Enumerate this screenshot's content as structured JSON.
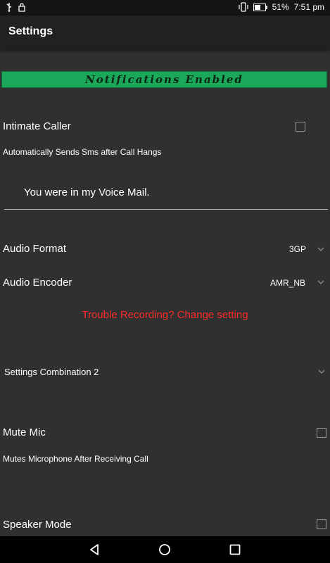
{
  "status_bar": {
    "battery": "51%",
    "time": "7:51 pm",
    "icons": [
      "usb-icon",
      "lock-icon",
      "vibrate-icon",
      "battery-icon"
    ]
  },
  "app_bar": {
    "title": "Settings"
  },
  "banner": {
    "text": "Notifications Enabled"
  },
  "intimate_caller": {
    "title": "Intimate Caller",
    "description": "Automatically Sends Sms after Call Hangs",
    "message": "You were in my Voice Mail."
  },
  "audio_format": {
    "label": "Audio Format",
    "value": "3GP"
  },
  "audio_encoder": {
    "label": "Audio Encoder",
    "value": "AMR_NB"
  },
  "trouble_link": {
    "text": "Trouble Recording? Change setting"
  },
  "settings_combination": {
    "value": "Settings Combination 2"
  },
  "mute_mic": {
    "title": "Mute Mic",
    "description": "Mutes Microphone After Receiving Call"
  },
  "speaker_mode": {
    "title": "Speaker Mode"
  },
  "colors": {
    "banner": "#1ba85a",
    "link": "#ff2b2b",
    "background": "#303030"
  }
}
